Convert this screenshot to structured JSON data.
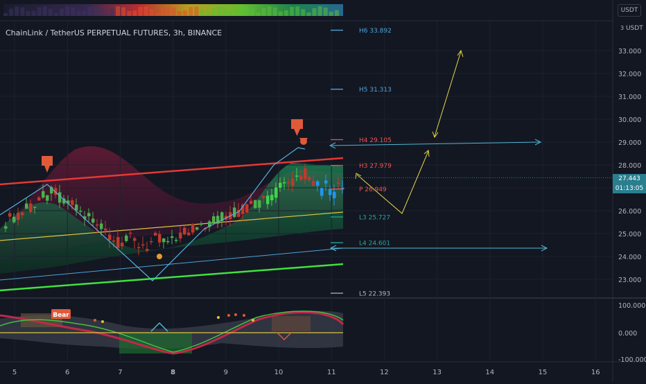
{
  "chart_title": "ChainLink / TetherUS PERPETUAL FUTURES, 3h, BINANCE",
  "currency_label": "USDT",
  "top_axis_label": "USDT",
  "corner_digit": "3",
  "price_badge": "27.443",
  "time_badge": "01:13:05",
  "osc_label": "Bear",
  "colors": {
    "bg": "#131722",
    "bull": "#26a69a",
    "bear": "#ef5350",
    "accent": "#2962ff"
  },
  "chart_data": [
    {
      "type": "line",
      "x_ticks": [
        "5",
        "6",
        "7",
        "8",
        "9",
        "10",
        "11",
        "12",
        "13",
        "14",
        "15",
        "16"
      ],
      "y_ticks": [
        "33.000",
        "32.000",
        "31.000",
        "30.000",
        "29.000",
        "28.000",
        "27.000",
        "26.000",
        "25.000",
        "24.000",
        "23.000"
      ],
      "ylim": [
        22.3,
        34.0
      ],
      "pivots": [
        {
          "label": "H6 33.892",
          "value": 33.892,
          "color": "#4fa3d9"
        },
        {
          "label": "H5 31.313",
          "value": 31.313,
          "color": "#4fa3d9"
        },
        {
          "label": "H4 29.105",
          "value": 29.105,
          "color": "#ef5350"
        },
        {
          "label": "H3 27.979",
          "value": 27.979,
          "color": "#ef5350"
        },
        {
          "label": "P 26.949",
          "value": 26.949,
          "color": "#ef5350"
        },
        {
          "label": "L3 25.727",
          "value": 25.727,
          "color": "#26a69a"
        },
        {
          "label": "L4 24.601",
          "value": 24.601,
          "color": "#26a69a"
        },
        {
          "label": "L5 22.393",
          "value": 22.393,
          "color": "#b2b5be"
        }
      ],
      "last_price": 27.443
    },
    {
      "type": "line",
      "y_ticks": [
        "100.000",
        "0.000",
        "-100.000"
      ],
      "ylim": [
        -110,
        110
      ]
    }
  ]
}
